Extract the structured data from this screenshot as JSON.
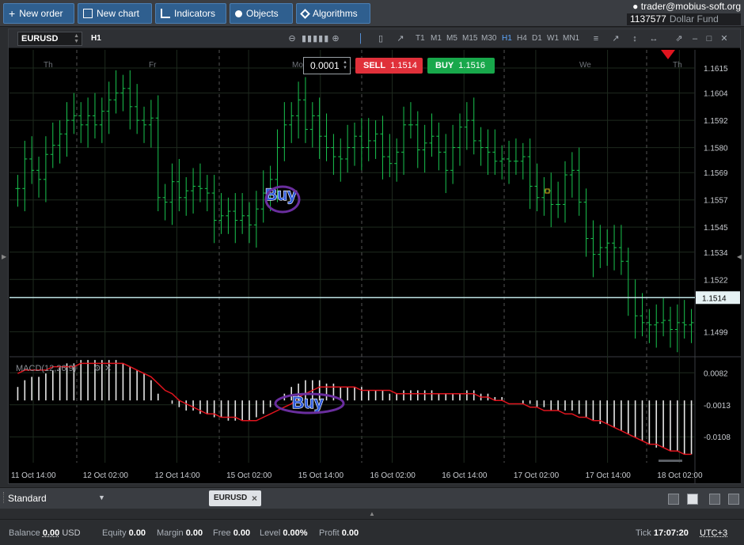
{
  "toolbar": {
    "buttons": [
      {
        "label": "New order",
        "icon": "plus-icon"
      },
      {
        "label": "New chart",
        "icon": "chart-icon"
      },
      {
        "label": "Indicators",
        "icon": "bar-chart-icon"
      },
      {
        "label": "Objects",
        "icon": "shapes-icon"
      },
      {
        "label": "Algorithms",
        "icon": "diamond-icon"
      }
    ]
  },
  "account": {
    "user": "trader@mobius-soft.org",
    "id": "1137577",
    "fund": "Dollar Fund"
  },
  "chart_window": {
    "symbol": "EURUSD",
    "timeframe": "H1",
    "timeframes": [
      "T1",
      "M1",
      "M5",
      "M15",
      "M30",
      "H1",
      "H4",
      "D1",
      "W1",
      "MN1"
    ],
    "active_timeframe": "H1"
  },
  "order_panel": {
    "volume": "0.0001",
    "sell_label": "SELL",
    "sell_price": "1.1514",
    "buy_label": "BUY",
    "buy_price": "1.1516"
  },
  "chart_data": {
    "type": "ohlc",
    "symbol": "EURUSD",
    "timeframe": "H1",
    "day_labels": [
      "Th",
      "Fr",
      "Mo",
      "We",
      "Th"
    ],
    "x_tick_labels": [
      "11 Oct 14:00",
      "12 Oct 02:00",
      "12 Oct 14:00",
      "15 Oct 02:00",
      "15 Oct 14:00",
      "16 Oct 02:00",
      "16 Oct 14:00",
      "17 Oct 02:00",
      "17 Oct 14:00",
      "18 Oct 02:00"
    ],
    "y_tick_labels": [
      "1.1615",
      "1.1604",
      "1.1592",
      "1.1580",
      "1.1569",
      "1.1557",
      "1.1545",
      "1.1534",
      "1.1522",
      "1.1499"
    ],
    "ylim": [
      1.1488,
      1.1623
    ],
    "current_price": "1.1514",
    "close": [
      1.1562,
      1.1575,
      1.157,
      1.1566,
      1.1577,
      1.1581,
      1.1586,
      1.1592,
      1.1594,
      1.159,
      1.1594,
      1.159,
      1.1596,
      1.1601,
      1.1604,
      1.1606,
      1.1598,
      1.1592,
      1.159,
      1.1593,
      1.1558,
      1.1556,
      1.1565,
      1.1558,
      1.1561,
      1.1563,
      1.1562,
      1.156,
      1.1548,
      1.155,
      1.1552,
      1.1548,
      1.155,
      1.1546,
      1.1553,
      1.156,
      1.1566,
      1.158,
      1.159,
      1.1594,
      1.1601,
      1.1588,
      1.1594,
      1.1585,
      1.158,
      1.1576,
      1.1575,
      1.158,
      1.1585,
      1.158,
      1.1583,
      1.1586,
      1.1576,
      1.1573,
      1.1578,
      1.159,
      1.159,
      1.1579,
      1.1582,
      1.1585,
      1.1578,
      1.157,
      1.158,
      1.1589,
      1.1592,
      1.1583,
      1.158,
      1.1578,
      1.1574,
      1.1575,
      1.1574,
      1.1574,
      1.1576,
      1.1563,
      1.1558,
      1.1561,
      1.1555,
      1.1555,
      1.1568,
      1.157,
      1.1556,
      1.154,
      1.1533,
      1.1536,
      1.1538,
      1.1536,
      1.153,
      1.1514,
      1.1506,
      1.1503,
      1.1502,
      1.1503,
      1.1504,
      1.15,
      1.1503,
      1.1502,
      1.1503
    ],
    "annotations": [
      "Buy",
      "Buy"
    ],
    "indicator": {
      "name": "MACD(12,26,9)",
      "y_tick_labels": [
        "0.0082",
        "-0.0013",
        "-0.0108"
      ],
      "histogram": [
        0.004,
        0.006,
        0.007,
        0.007,
        0.008,
        0.009,
        0.01,
        0.011,
        0.011,
        0.012,
        0.012,
        0.012,
        0.012,
        0.012,
        0.012,
        0.011,
        0.01,
        0.009,
        0.008,
        0.006,
        0.002,
        0.0,
        -0.001,
        -0.002,
        -0.003,
        -0.003,
        -0.004,
        -0.004,
        -0.005,
        -0.005,
        -0.006,
        -0.006,
        -0.006,
        -0.006,
        -0.005,
        -0.004,
        -0.002,
        0.0,
        0.002,
        0.004,
        0.005,
        0.006,
        0.006,
        0.006,
        0.005,
        0.005,
        0.004,
        0.004,
        0.004,
        0.004,
        0.003,
        0.003,
        0.003,
        0.002,
        0.002,
        0.003,
        0.003,
        0.003,
        0.003,
        0.003,
        0.002,
        0.002,
        0.002,
        0.002,
        0.003,
        0.003,
        0.002,
        0.002,
        0.001,
        0.001,
        0.0,
        0.0,
        -0.001,
        -0.001,
        -0.002,
        -0.002,
        -0.003,
        -0.003,
        -0.003,
        -0.003,
        -0.004,
        -0.005,
        -0.006,
        -0.007,
        -0.007,
        -0.008,
        -0.009,
        -0.01,
        -0.011,
        -0.012,
        -0.013,
        -0.014,
        -0.014,
        -0.015,
        -0.015,
        -0.016,
        -0.016
      ],
      "signal": [
        0.008,
        0.009,
        0.009,
        0.009,
        0.009,
        0.01,
        0.01,
        0.01,
        0.01,
        0.011,
        0.011,
        0.011,
        0.011,
        0.011,
        0.011,
        0.011,
        0.01,
        0.009,
        0.008,
        0.007,
        0.005,
        0.003,
        0.002,
        0.0,
        -0.001,
        -0.002,
        -0.003,
        -0.004,
        -0.004,
        -0.005,
        -0.005,
        -0.005,
        -0.006,
        -0.006,
        -0.006,
        -0.005,
        -0.004,
        -0.003,
        -0.002,
        -0.001,
        0.001,
        0.002,
        0.003,
        0.004,
        0.004,
        0.004,
        0.004,
        0.004,
        0.004,
        0.003,
        0.003,
        0.003,
        0.003,
        0.003,
        0.002,
        0.002,
        0.002,
        0.002,
        0.002,
        0.002,
        0.002,
        0.002,
        0.002,
        0.002,
        0.002,
        0.002,
        0.001,
        0.001,
        0.0,
        0.0,
        -0.001,
        -0.001,
        -0.001,
        -0.002,
        -0.002,
        -0.003,
        -0.003,
        -0.003,
        -0.004,
        -0.004,
        -0.005,
        -0.005,
        -0.006,
        -0.006,
        -0.007,
        -0.008,
        -0.009,
        -0.01,
        -0.011,
        -0.012,
        -0.013,
        -0.013,
        -0.014,
        -0.015,
        -0.015,
        -0.016,
        -0.016
      ]
    }
  },
  "bottom_bar": {
    "layout": "Standard",
    "tab": "EURUSD"
  },
  "status": {
    "balance_label": "Balance",
    "balance": "0.00",
    "currency": "USD",
    "equity_label": "Equity",
    "equity": "0.00",
    "margin_label": "Margin",
    "margin": "0.00",
    "free_label": "Free",
    "free": "0.00",
    "level_label": "Level",
    "level": "0.00%",
    "profit_label": "Profit",
    "profit": "0.00",
    "tick_label": "Tick",
    "tick": "17:07:20",
    "tz": "UTC+3"
  },
  "colors": {
    "bull": "#19c44f",
    "bear": "#19c44f",
    "signal": "#e0141e",
    "annotation": "#6a2e9e",
    "sell": "#e0303a",
    "buy": "#18a84b"
  }
}
